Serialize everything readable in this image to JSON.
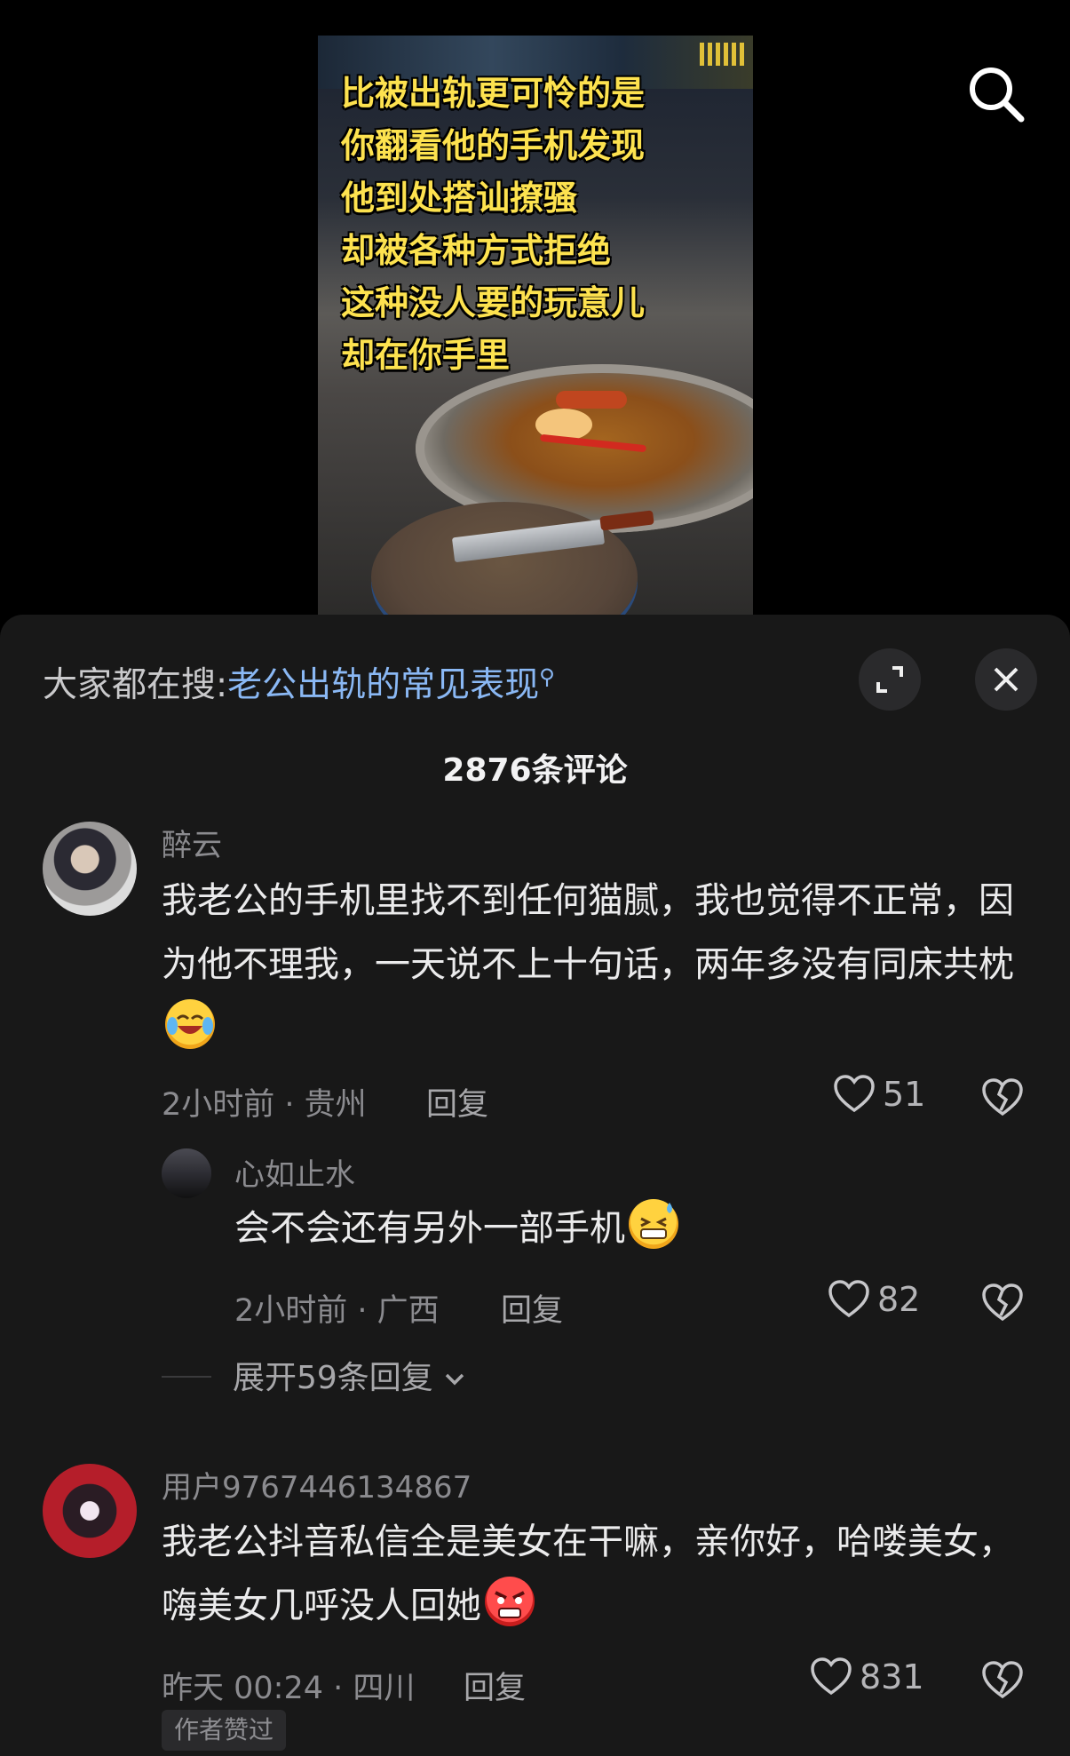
{
  "video": {
    "caption_lines": [
      "比被出轨更可怜的是",
      "你翻看他的手机发现",
      "他到处搭讪撩骚",
      "却被各种方式拒绝",
      "这种没人要的玩意儿",
      "却在你手里"
    ],
    "search_icon": "search-icon"
  },
  "sheet": {
    "hot_prefix": "大家都在搜:",
    "hot_keyword": "老公出轨的常见表现",
    "expand_icon": "expand-icon",
    "close_icon": "close-icon",
    "comment_count": "2876条评论"
  },
  "comments": [
    {
      "user": "醉云",
      "text": "我老公的手机里找不到任何猫腻，我也觉得不正常，因为他不理我，一天说不上十句话，两年多没有同床共枕",
      "emoji": "crying-laughing-emoji",
      "meta": "2小时前 · 贵州",
      "reply_label": "回复",
      "likes": "51"
    },
    {
      "user": "心如止水",
      "text": "会不会还有另外一部手机",
      "emoji": "sweat-grin-emoji",
      "meta": "2小时前 · 广西",
      "reply_label": "回复",
      "likes": "82"
    },
    {
      "user": "用户9767446134867",
      "text": "我老公抖音私信全是美女在干嘛，亲你好，哈喽美女，嗨美女几呼没人回她",
      "emoji": "angry-face-emoji",
      "meta": "昨天 00:24 · 四川",
      "reply_label": "回复",
      "likes": "831",
      "badge": "作者赞过"
    }
  ],
  "expand_replies": "展开59条回复",
  "colors": {
    "sheet_bg": "#181818",
    "keyword": "#8ab8f4",
    "caption": "#fde24f"
  }
}
